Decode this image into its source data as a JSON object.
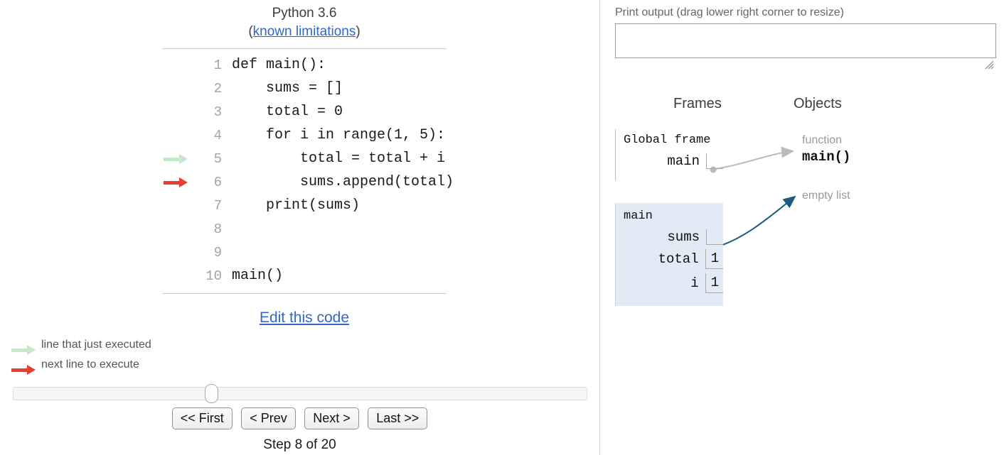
{
  "left": {
    "version_text": "Python 3.6",
    "limitations_prefix": "(",
    "limitations_link": "known limitations",
    "limitations_suffix": ")",
    "edit_link": "Edit this code",
    "code_lines": [
      {
        "num": "1",
        "text": "def main():",
        "marker": "none"
      },
      {
        "num": "2",
        "text": "    sums = []",
        "marker": "none"
      },
      {
        "num": "3",
        "text": "    total = 0",
        "marker": "none"
      },
      {
        "num": "4",
        "text": "    for i in range(1, 5):",
        "marker": "none"
      },
      {
        "num": "5",
        "text": "        total = total + i",
        "marker": "green"
      },
      {
        "num": "6",
        "text": "        sums.append(total)",
        "marker": "red"
      },
      {
        "num": "7",
        "text": "    print(sums)",
        "marker": "none"
      },
      {
        "num": "8",
        "text": "",
        "marker": "none"
      },
      {
        "num": "9",
        "text": "",
        "marker": "none"
      },
      {
        "num": "10",
        "text": "main()",
        "marker": "none"
      }
    ],
    "legend": {
      "executed": "line that just executed",
      "next": "next line to execute"
    },
    "controls": {
      "first": "<< First",
      "prev": "< Prev",
      "next": "Next >",
      "last": "Last >>"
    },
    "step_label": "Step 8 of 20",
    "slider": {
      "value": 8,
      "min": 1,
      "max": 20
    }
  },
  "right": {
    "print_output_label": "Print output (drag lower right corner to resize)",
    "print_output_value": "",
    "frames_header": "Frames",
    "objects_header": "Objects",
    "global_frame": {
      "title": "Global frame",
      "vars": [
        {
          "name": "main",
          "value": "",
          "is_pointer": true
        }
      ]
    },
    "main_frame": {
      "title": "main",
      "vars": [
        {
          "name": "sums",
          "value": "",
          "is_pointer": true
        },
        {
          "name": "total",
          "value": "1",
          "is_pointer": false
        },
        {
          "name": "i",
          "value": "1",
          "is_pointer": false
        }
      ]
    },
    "objects": [
      {
        "label": "function",
        "value": "main()"
      },
      {
        "label": "empty list",
        "value": ""
      }
    ]
  },
  "colors": {
    "link": "#3366cc",
    "green_arrow": "#c6e8c6",
    "red_arrow": "#ea3d2f",
    "frame_highlight": "#e2eaf5",
    "pointer_arrow": "#1a5b82",
    "function_arrow": "#bbbbbb"
  }
}
